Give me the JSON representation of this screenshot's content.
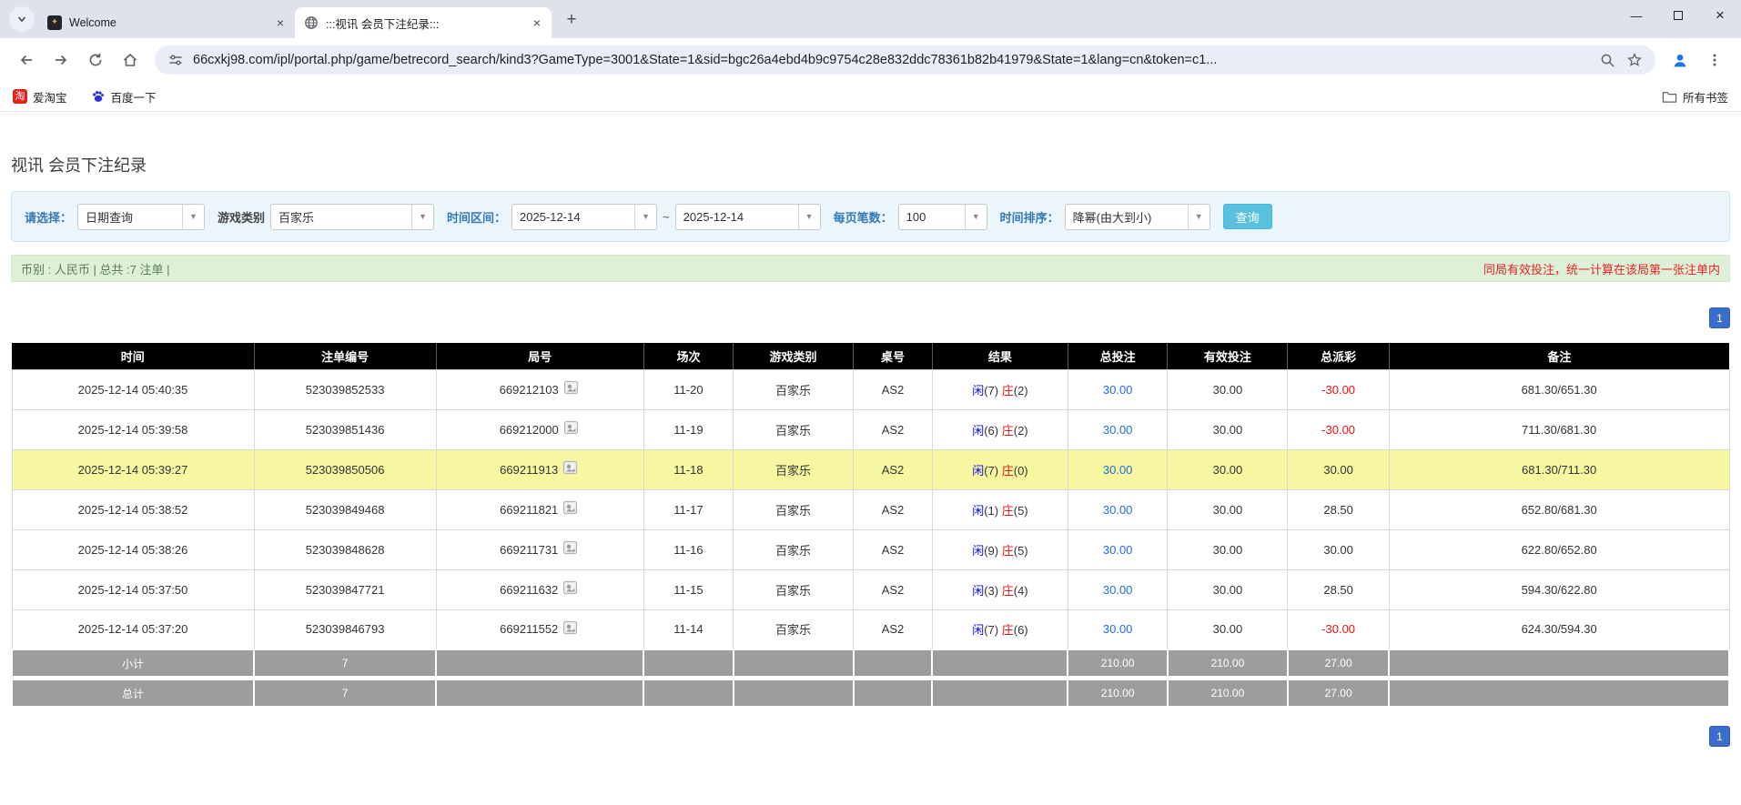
{
  "browser": {
    "tabs": [
      {
        "title": "Welcome"
      },
      {
        "title": ":::视讯 会员下注纪录:::"
      }
    ],
    "url": "66cxkj98.com/ipl/portal.php/game/betrecord_search/kind3?GameType=3001&State=1&sid=bgc26a4ebd4b9c9754c28e832ddc78361b82b41979&State=1&lang=cn&token=c1...",
    "bookmarks": [
      {
        "label": "爱淘宝"
      },
      {
        "label": "百度一下"
      }
    ],
    "all_bookmarks_label": "所有书签"
  },
  "page": {
    "title": "视讯 会员下注纪录",
    "filters": {
      "select_label": "请选择：",
      "select_value": "日期查询",
      "game_type_label": "游戏类别",
      "game_type_value": "百家乐",
      "date_range_label": "时间区间：",
      "date_from": "2025-12-14",
      "tilde": "~",
      "date_to": "2025-12-14",
      "page_size_label": "每页笔数：",
      "page_size_value": "100",
      "sort_label": "时间排序：",
      "sort_value": "降幂(由大到小)",
      "search_button": "查询"
    },
    "status": {
      "left": "币别 : 人民币 | 总共 :7 注单 |",
      "right": "同局有效投注，统一计算在该局第一张注单内"
    },
    "pagination": "1",
    "table": {
      "headers": [
        "时间",
        "注单编号",
        "局号",
        "场次",
        "游戏类别",
        "桌号",
        "结果",
        "总投注",
        "有效投注",
        "总派彩",
        "备注"
      ],
      "result_labels": {
        "player": "闲",
        "banker": "庄"
      },
      "rows": [
        {
          "time": "2025-12-14 05:40:35",
          "bet_id": "523039852533",
          "round": "669212103",
          "session": "11-20",
          "game": "百家乐",
          "table_no": "AS2",
          "player": "7",
          "banker": "2",
          "total_bet": "30.00",
          "valid_bet": "30.00",
          "payout": "-30.00",
          "remark": "681.30/651.30",
          "highlight": false
        },
        {
          "time": "2025-12-14 05:39:58",
          "bet_id": "523039851436",
          "round": "669212000",
          "session": "11-19",
          "game": "百家乐",
          "table_no": "AS2",
          "player": "6",
          "banker": "2",
          "total_bet": "30.00",
          "valid_bet": "30.00",
          "payout": "-30.00",
          "remark": "711.30/681.30",
          "highlight": false
        },
        {
          "time": "2025-12-14 05:39:27",
          "bet_id": "523039850506",
          "round": "669211913",
          "session": "11-18",
          "game": "百家乐",
          "table_no": "AS2",
          "player": "7",
          "banker": "0",
          "total_bet": "30.00",
          "valid_bet": "30.00",
          "payout": "30.00",
          "remark": "681.30/711.30",
          "highlight": true
        },
        {
          "time": "2025-12-14 05:38:52",
          "bet_id": "523039849468",
          "round": "669211821",
          "session": "11-17",
          "game": "百家乐",
          "table_no": "AS2",
          "player": "1",
          "banker": "5",
          "total_bet": "30.00",
          "valid_bet": "30.00",
          "payout": "28.50",
          "remark": "652.80/681.30",
          "highlight": false
        },
        {
          "time": "2025-12-14 05:38:26",
          "bet_id": "523039848628",
          "round": "669211731",
          "session": "11-16",
          "game": "百家乐",
          "table_no": "AS2",
          "player": "9",
          "banker": "5",
          "total_bet": "30.00",
          "valid_bet": "30.00",
          "payout": "30.00",
          "remark": "622.80/652.80",
          "highlight": false
        },
        {
          "time": "2025-12-14 05:37:50",
          "bet_id": "523039847721",
          "round": "669211632",
          "session": "11-15",
          "game": "百家乐",
          "table_no": "AS2",
          "player": "3",
          "banker": "4",
          "total_bet": "30.00",
          "valid_bet": "30.00",
          "payout": "28.50",
          "remark": "594.30/622.80",
          "highlight": false
        },
        {
          "time": "2025-12-14 05:37:20",
          "bet_id": "523039846793",
          "round": "669211552",
          "session": "11-14",
          "game": "百家乐",
          "table_no": "AS2",
          "player": "7",
          "banker": "6",
          "total_bet": "30.00",
          "valid_bet": "30.00",
          "payout": "-30.00",
          "remark": "624.30/594.30",
          "highlight": false
        }
      ],
      "subtotal": {
        "label": "小计",
        "count": "7",
        "total_bet": "210.00",
        "valid_bet": "210.00",
        "payout": "27.00"
      },
      "total": {
        "label": "总计",
        "count": "7",
        "total_bet": "210.00",
        "valid_bet": "210.00",
        "payout": "27.00"
      }
    },
    "colors": {
      "header_bg": "#000000",
      "footer_bg": "#9d9d9d",
      "highlight_row": "#f7f7a1",
      "link_blue": "#1a6fd9",
      "negative_red": "#ee1111",
      "player_blue": "#0b0be0",
      "banker_red": "#e01414",
      "search_button": "#5bc0de",
      "pagination_blue": "#3a6ecb",
      "status_bg": "#dff0d8",
      "filter_bg": "#eaf5fc"
    }
  }
}
